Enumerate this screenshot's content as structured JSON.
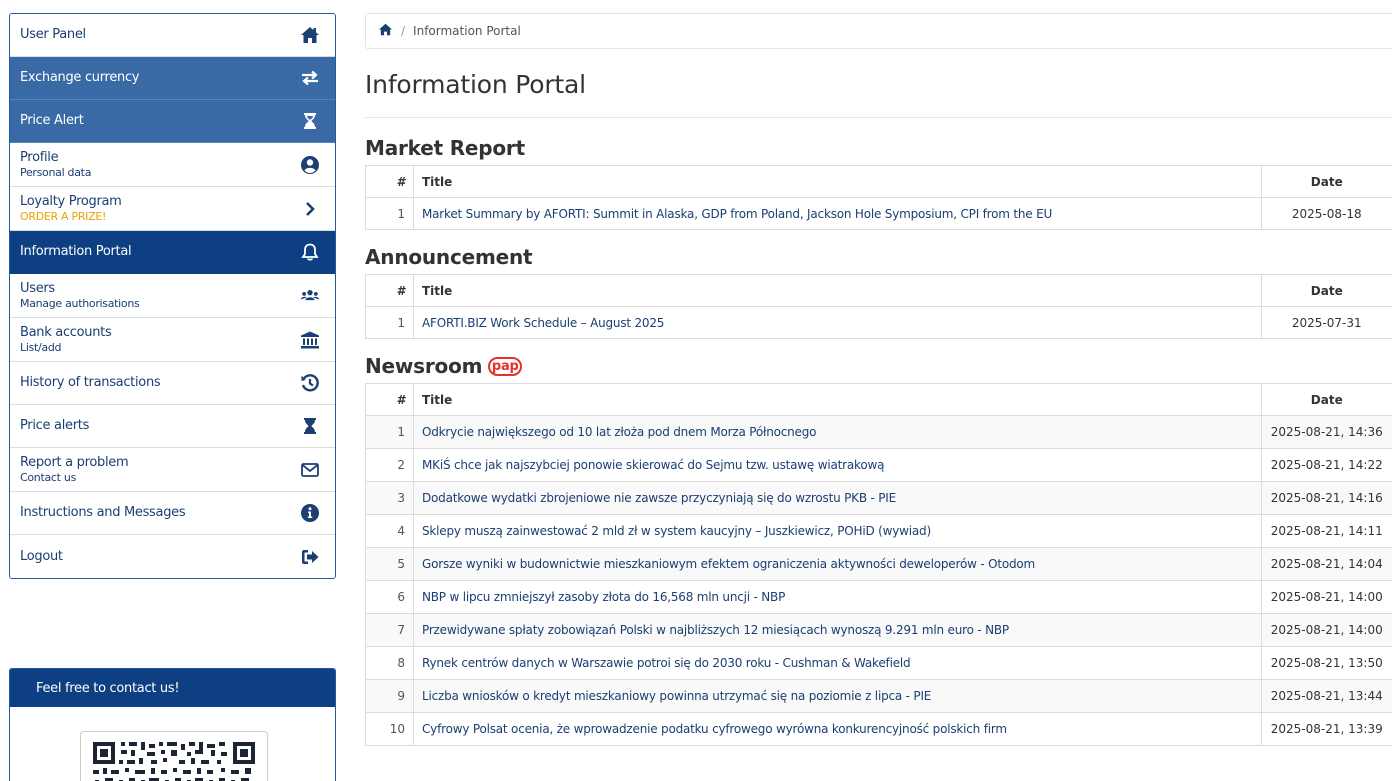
{
  "sidebar": {
    "items": [
      {
        "label": "User Panel",
        "sub": "",
        "icon": "home-icon"
      },
      {
        "label": "Exchange currency",
        "sub": "",
        "icon": "exchange-icon"
      },
      {
        "label": "Price Alert",
        "sub": "",
        "icon": "hourglass-icon"
      },
      {
        "label": "Profile",
        "sub": "Personal data",
        "icon": "user-circle-icon"
      },
      {
        "label": "Loyalty Program",
        "sub": "ORDER A PRIZE!",
        "icon": "chevron-right-icon"
      },
      {
        "label": "Information Portal",
        "sub": "",
        "icon": "bell-icon"
      },
      {
        "label": "Users",
        "sub": "Manage authorisations",
        "icon": "users-icon"
      },
      {
        "label": "Bank accounts",
        "sub": "List/add",
        "icon": "bank-icon"
      },
      {
        "label": "History of transactions",
        "sub": "",
        "icon": "history-icon"
      },
      {
        "label": "Price alerts",
        "sub": "",
        "icon": "hourglass-icon"
      },
      {
        "label": "Report a problem",
        "sub": "Contact us",
        "icon": "envelope-icon"
      },
      {
        "label": "Instructions and Messages",
        "sub": "",
        "icon": "info-circle-icon"
      },
      {
        "label": "Logout",
        "sub": "",
        "icon": "sign-out-icon"
      }
    ]
  },
  "contact": {
    "heading": "Feel free to contact us!"
  },
  "breadcrumb": {
    "current": "Information Portal",
    "separator": "/"
  },
  "page_title": "Information Portal",
  "market_report": {
    "title": "Market Report",
    "headers": {
      "num": "#",
      "title": "Title",
      "date": "Date"
    },
    "rows": [
      {
        "num": "1",
        "title": "Market Summary by AFORTI: Summit in Alaska, GDP from Poland, Jackson Hole Symposium, CPI from the EU",
        "date": "2025-08-18"
      }
    ]
  },
  "announcement": {
    "title": "Announcement",
    "headers": {
      "num": "#",
      "title": "Title",
      "date": "Date"
    },
    "rows": [
      {
        "num": "1",
        "title": "AFORTI.BIZ Work Schedule – August 2025",
        "date": "2025-07-31"
      }
    ]
  },
  "newsroom": {
    "title": "Newsroom",
    "logo": "pap",
    "headers": {
      "num": "#",
      "title": "Title",
      "date": "Date"
    },
    "rows": [
      {
        "num": "1",
        "title": "Odkrycie największego od 10 lat złoża pod dnem Morza Północnego",
        "date": "2025-08-21, 14:36"
      },
      {
        "num": "2",
        "title": "MKiŚ chce jak najszybciej ponowie skierować do Sejmu tzw. ustawę wiatrakową",
        "date": "2025-08-21, 14:22"
      },
      {
        "num": "3",
        "title": "Dodatkowe wydatki zbrojeniowe nie zawsze przyczyniają się do wzrostu PKB - PIE",
        "date": "2025-08-21, 14:16"
      },
      {
        "num": "4",
        "title": "Sklepy muszą zainwestować 2 mld zł w system kaucyjny – Juszkiewicz, POHiD (wywiad)",
        "date": "2025-08-21, 14:11"
      },
      {
        "num": "5",
        "title": "Gorsze wyniki w budownictwie mieszkaniowym efektem ograniczenia aktywności deweloperów - Otodom",
        "date": "2025-08-21, 14:04"
      },
      {
        "num": "6",
        "title": "NBP w lipcu zmniejszył zasoby złota do 16,568 mln uncji - NBP",
        "date": "2025-08-21, 14:00"
      },
      {
        "num": "7",
        "title": "Przewidywane spłaty zobowiązań Polski w najbliższych 12 miesiącach wynoszą 9.291 mln euro - NBP",
        "date": "2025-08-21, 14:00"
      },
      {
        "num": "8",
        "title": "Rynek centrów danych w Warszawie potroi się do 2030 roku - Cushman & Wakefield",
        "date": "2025-08-21, 13:50"
      },
      {
        "num": "9",
        "title": "Liczba wniosków o kredyt mieszkaniowy powinna utrzymać się na poziomie z lipca - PIE",
        "date": "2025-08-21, 13:44"
      },
      {
        "num": "10",
        "title": "Cyfrowy Polsat ocenia, że wprowadzenie podatku cyfrowego wyrówna konkurencyjność polskich firm",
        "date": "2025-08-21, 13:39"
      }
    ]
  },
  "colors": {
    "nav_dark": "#0d3f82",
    "nav_medium": "#3a6aa6",
    "link": "#1b3f73",
    "loyalty_gold": "#e8a300",
    "pap_red": "#e4312b"
  }
}
